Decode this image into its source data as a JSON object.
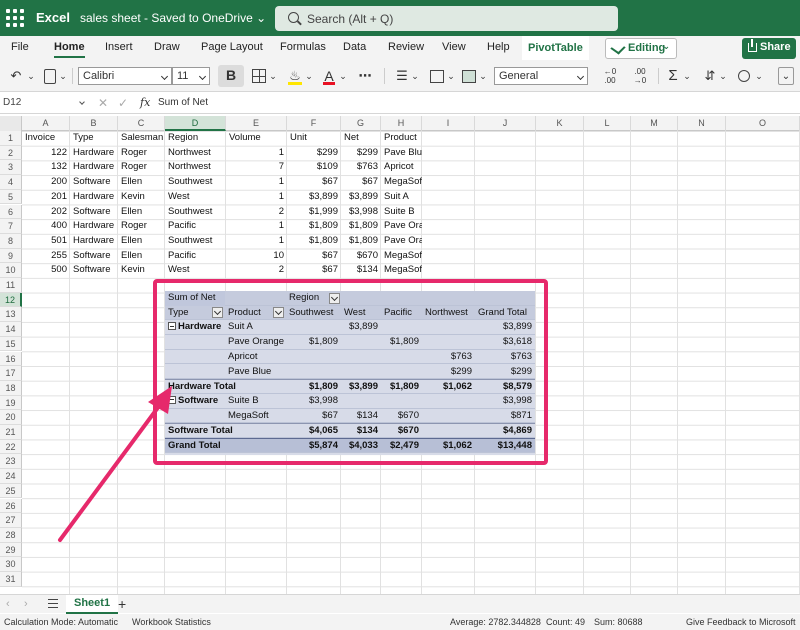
{
  "titlebar": {
    "app_name": "Excel",
    "document": "sales sheet - Saved to OneDrive ⌄",
    "search_placeholder": "Search (Alt + Q)"
  },
  "menu": {
    "tabs": [
      "File",
      "Home",
      "Insert",
      "Draw",
      "Page Layout",
      "Formulas",
      "Data",
      "Review",
      "View",
      "Help",
      "PivotTable"
    ],
    "active": "Home",
    "editing": "Editing",
    "share": "Share"
  },
  "toolbar": {
    "font": "Calibri",
    "font_size": "11",
    "bold": "B",
    "number_format": "General"
  },
  "formula_bar": {
    "name_box": "D12",
    "content": "Sum of Net"
  },
  "columns": [
    "A",
    "B",
    "C",
    "D",
    "E",
    "F",
    "G",
    "H",
    "I",
    "J",
    "K",
    "L",
    "M",
    "N",
    "O"
  ],
  "selected_column": "D",
  "selected_row": 12,
  "row_numbers": [
    1,
    2,
    3,
    4,
    5,
    6,
    7,
    8,
    9,
    10,
    11,
    12,
    13,
    14,
    15,
    16,
    17,
    18,
    19,
    20,
    21,
    22,
    23,
    24,
    25,
    26,
    27,
    28,
    29,
    30,
    31
  ],
  "table": {
    "headers": [
      "Invoice",
      "Type",
      "Salesman",
      "Region",
      "Volume",
      "Unit",
      "Net",
      "Product"
    ],
    "rows": [
      [
        "122",
        "Hardware",
        "Roger",
        "Northwest",
        "1",
        "$299",
        "$299",
        "Pave Blue"
      ],
      [
        "132",
        "Hardware",
        "Roger",
        "Northwest",
        "7",
        "$109",
        "$763",
        "Apricot"
      ],
      [
        "200",
        "Software",
        "Ellen",
        "Southwest",
        "1",
        "$67",
        "$67",
        "MegaSoft"
      ],
      [
        "201",
        "Hardware",
        "Kevin",
        "West",
        "1",
        "$3,899",
        "$3,899",
        "Suit A"
      ],
      [
        "202",
        "Software",
        "Ellen",
        "Southwest",
        "2",
        "$1,999",
        "$3,998",
        "Suite B"
      ],
      [
        "400",
        "Hardware",
        "Roger",
        "Pacific",
        "1",
        "$1,809",
        "$1,809",
        "Pave Orange"
      ],
      [
        "501",
        "Hardware",
        "Ellen",
        "Southwest",
        "1",
        "$1,809",
        "$1,809",
        "Pave Orange"
      ],
      [
        "255",
        "Software",
        "Ellen",
        "Pacific",
        "10",
        "$67",
        "$670",
        "MegaSoft"
      ],
      [
        "500",
        "Software",
        "Kevin",
        "West",
        "2",
        "$67",
        "$134",
        "MegaSoft"
      ]
    ]
  },
  "pivot": {
    "title": "Sum of Net",
    "region_label": "Region",
    "col_headers": [
      "Type",
      "Product",
      "Southwest",
      "West",
      "Pacific",
      "Northwest",
      "Grand Total"
    ],
    "rows": [
      {
        "type": "Hardware",
        "product": "Suit A",
        "vals": [
          "",
          "$3,899",
          "",
          "",
          "$3,899"
        ]
      },
      {
        "type": "",
        "product": "Pave Orange",
        "vals": [
          "$1,809",
          "",
          "$1,809",
          "",
          "$3,618"
        ]
      },
      {
        "type": "",
        "product": "Apricot",
        "vals": [
          "",
          "",
          "",
          "$763",
          "$763"
        ]
      },
      {
        "type": "",
        "product": "Pave Blue",
        "vals": [
          "",
          "",
          "",
          "$299",
          "$299"
        ]
      },
      {
        "total": "Hardware Total",
        "vals": [
          "$1,809",
          "$3,899",
          "$1,809",
          "$1,062",
          "$8,579"
        ]
      },
      {
        "type": "Software",
        "product": "Suite B",
        "vals": [
          "$3,998",
          "",
          "",
          "",
          "$3,998"
        ]
      },
      {
        "type": "",
        "product": "MegaSoft",
        "vals": [
          "$67",
          "$134",
          "$670",
          "",
          "$871"
        ]
      },
      {
        "total": "Software Total",
        "vals": [
          "$4,065",
          "$134",
          "$670",
          "",
          "$4,869"
        ]
      },
      {
        "grand": "Grand Total",
        "vals": [
          "$5,874",
          "$4,033",
          "$2,479",
          "$1,062",
          "$13,448"
        ]
      }
    ]
  },
  "sheets": {
    "active": "Sheet1",
    "add": "+"
  },
  "status": {
    "calc_mode": "Calculation Mode: Automatic",
    "workbook_stats": "Workbook Statistics",
    "average": "Average: 2782.344828",
    "count": "Count: 49",
    "sum": "Sum: 80688",
    "feedback": "Give Feedback to Microsoft"
  },
  "colors": {
    "excel_green": "#217346",
    "highlight": "#e6296b",
    "pivot_bg": "#d7dbe8"
  }
}
